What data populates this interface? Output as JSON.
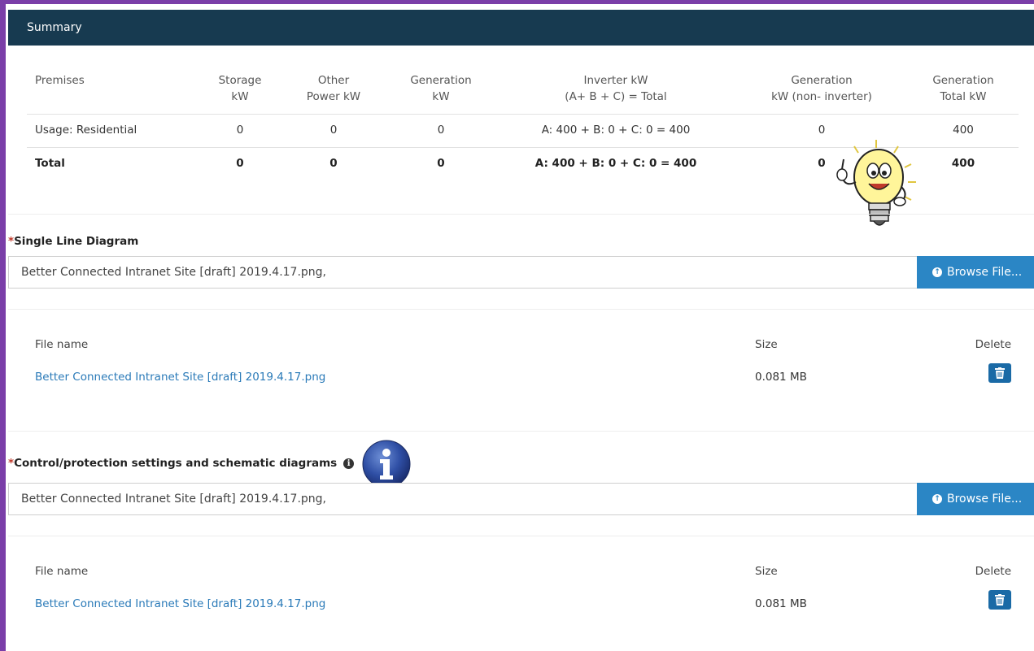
{
  "summary": {
    "title": "Summary",
    "headers": [
      [
        "Premises"
      ],
      [
        "Storage",
        "kW"
      ],
      [
        "Other",
        "Power kW"
      ],
      [
        "Generation",
        "kW"
      ],
      [
        "Inverter kW",
        "(A+ B + C) = Total"
      ],
      [
        "Generation",
        "kW (non- inverter)"
      ],
      [
        "Generation",
        "Total kW"
      ]
    ],
    "rows": [
      [
        "Usage: Residential",
        "0",
        "0",
        "0",
        "A: 400 + B: 0 + C: 0 = 400",
        "0",
        "400"
      ]
    ],
    "total": [
      "Total",
      "0",
      "0",
      "0",
      "A: 400 + B: 0 + C: 0 = 400",
      "0",
      "400"
    ]
  },
  "single_line": {
    "required_mark": "*",
    "label": "Single Line Diagram",
    "input_value": "Better Connected Intranet Site [draft] 2019.4.17.png,",
    "browse_label": "Browse File...",
    "col_file_name": "File name",
    "col_size": "Size",
    "col_delete": "Delete",
    "files": [
      {
        "name": "Better Connected Intranet Site [draft] 2019.4.17.png",
        "size": "0.081 MB"
      }
    ]
  },
  "control": {
    "required_mark": "*",
    "label": "Control/protection settings and schematic diagrams",
    "info_glyph": "i",
    "input_value": "Better Connected Intranet Site [draft] 2019.4.17.png,",
    "browse_label": "Browse File...",
    "col_file_name": "File name",
    "col_size": "Size",
    "col_delete": "Delete",
    "files": [
      {
        "name": "Better Connected Intranet Site [draft] 2019.4.17.png",
        "size": "0.081 MB"
      }
    ]
  },
  "colors": {
    "header_bg": "#173a50",
    "accent_button": "#2b86c5",
    "delete_button": "#1a6aa6",
    "link": "#2a7ab8",
    "frame": "#7a3ea8"
  },
  "icons": [
    "upload-circle-icon",
    "trash-icon",
    "info-icon",
    "lightbulb-mascot-icon",
    "info-badge-icon"
  ]
}
